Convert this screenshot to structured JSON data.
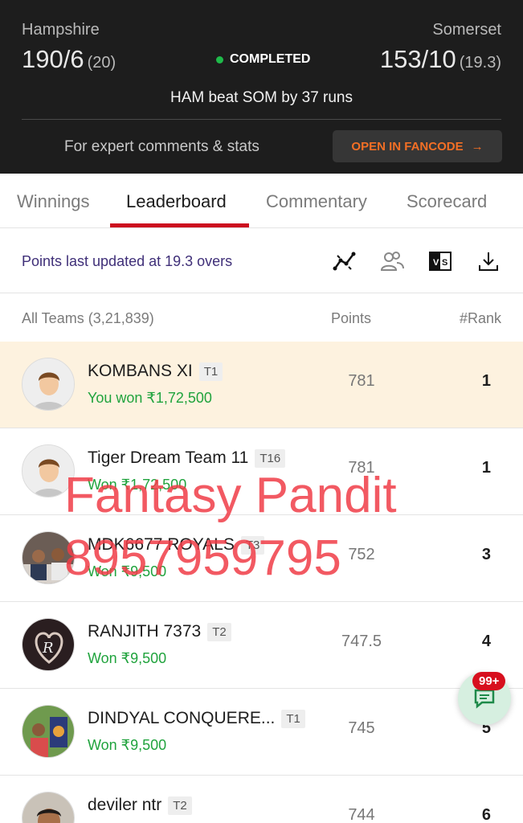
{
  "header": {
    "team_left": "Hampshire",
    "team_right": "Somerset",
    "score_left": "190/6",
    "overs_left": "(20)",
    "score_right": "153/10",
    "overs_right": "(19.3)",
    "status": "COMPLETED",
    "result": "HAM beat SOM by 37 runs",
    "expert_text": "For expert comments & stats",
    "fancode_button": "OPEN IN FANCODE",
    "fancode_arrow": "→"
  },
  "tabs": [
    "Winnings",
    "Leaderboard",
    "Commentary",
    "Scorecard"
  ],
  "points_bar": {
    "text": "Points last updated at 19.3 overs",
    "icons": [
      "trend-chart-icon",
      "compare-users-icon",
      "versus-icon",
      "download-icon"
    ]
  },
  "columns": {
    "teams": "All Teams (3,21,839)",
    "points": "Points",
    "rank": "#Rank"
  },
  "rows": [
    {
      "name": "KOMBANS XI",
      "tag": "T1",
      "won": "You won ₹1,72,500",
      "points": "781",
      "rank": "1"
    },
    {
      "name": "Tiger Dream Team 11",
      "tag": "T16",
      "won": "Won ₹1,72,500",
      "points": "781",
      "rank": "1"
    },
    {
      "name": "MDK6677 ROYALS",
      "tag": "T3",
      "won": "Won ₹9,500",
      "points": "752",
      "rank": "3"
    },
    {
      "name": "RANJITH 7373",
      "tag": "T2",
      "won": "Won ₹9,500",
      "points": "747.5",
      "rank": "4"
    },
    {
      "name": "DINDYAL CONQUERE...",
      "tag": "T1",
      "won": "Won ₹9,500",
      "points": "745",
      "rank": "5"
    },
    {
      "name": "deviler ntr",
      "tag": "T2",
      "won": "",
      "points": "744",
      "rank": "6"
    }
  ],
  "watermark": {
    "line1": "Fantasy Pandit",
    "line2": "8957959795"
  },
  "chat": {
    "badge": "99+"
  }
}
